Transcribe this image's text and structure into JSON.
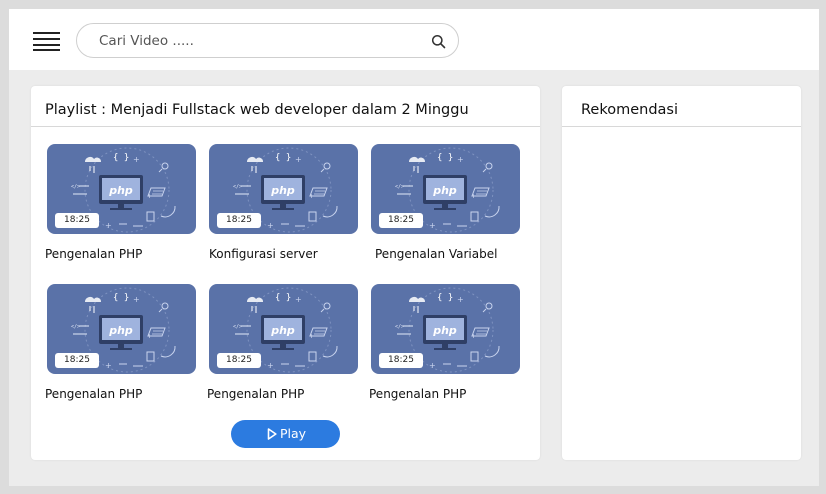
{
  "search": {
    "placeholder": "Cari Video ....."
  },
  "playlist": {
    "title": "Playlist : Menjadi Fullstack web developer dalam 2 Minggu",
    "thumbnail_label": "php",
    "thumbnail_color": "#5a72a8",
    "videos": [
      {
        "title": "Pengenalan PHP",
        "duration": "18:25"
      },
      {
        "title": "Konfigurasi server",
        "duration": "18:25"
      },
      {
        "title": "Pengenalan Variabel",
        "duration": "18:25"
      },
      {
        "title": "Pengenalan PHP",
        "duration": "18:25"
      },
      {
        "title": "Pengenalan PHP",
        "duration": "18:25"
      },
      {
        "title": "Pengenalan PHP",
        "duration": "18:25"
      }
    ],
    "play_label": "Play"
  },
  "recommendation": {
    "title": "Rekomendasi"
  },
  "colors": {
    "accent": "#2c7be0",
    "thumbnail_bg": "#5a72a8",
    "page_bg": "#ececec"
  }
}
